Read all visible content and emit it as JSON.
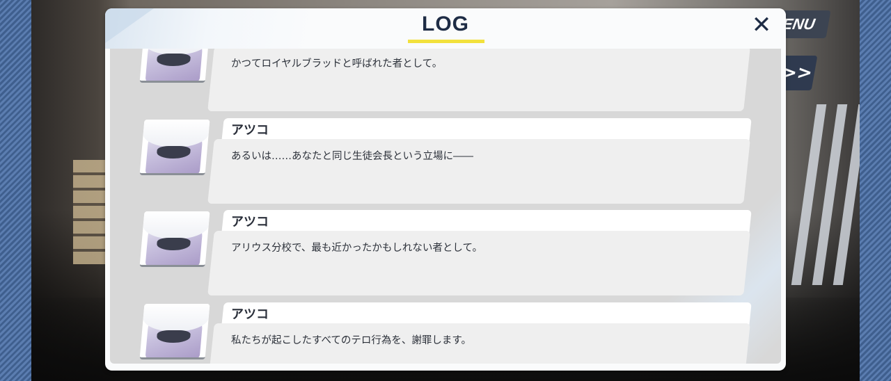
{
  "scene": {
    "menu_label": "ENU",
    "skip_label": ">>"
  },
  "log": {
    "title": "LOG",
    "close_label": "✕",
    "entries": [
      {
        "speaker": "",
        "text": "かつてロイヤルブラッドと呼ばれた者として。"
      },
      {
        "speaker": "アツコ",
        "text": "あるいは……あなたと同じ生徒会長という立場に――"
      },
      {
        "speaker": "アツコ",
        "text": "アリウス分校で、最も近かったかもしれない者として。"
      },
      {
        "speaker": "アツコ",
        "text": "私たちが起こしたすべてのテロ行為を、謝罪します。"
      }
    ]
  },
  "colors": {
    "title": "#1e2c45",
    "title_underline": "#f2e13d",
    "panel": "#fafbfc",
    "body": "#d8d8d8"
  },
  "icons": {
    "close": "close-icon",
    "skip": "fast-forward-icon",
    "portrait": "atsuko-portrait"
  }
}
